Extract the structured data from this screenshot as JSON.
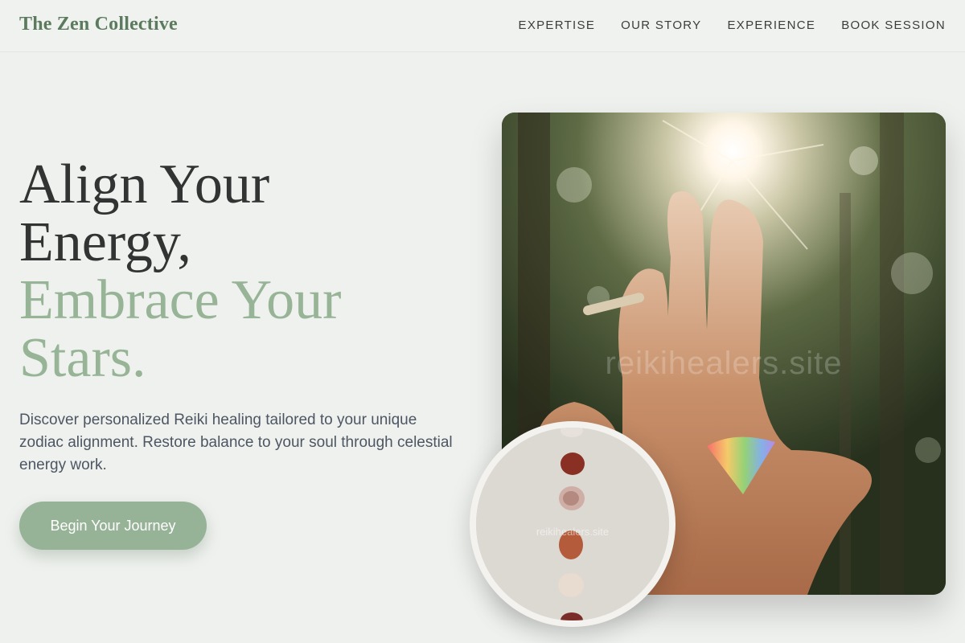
{
  "header": {
    "brand": "The Zen Collective",
    "nav": [
      "EXPERTISE",
      "OUR STORY",
      "EXPERIENCE",
      "BOOK SESSION"
    ]
  },
  "hero": {
    "headline_line1": "Align Your",
    "headline_line2": "Energy,",
    "headline_line3": "Embrace Your",
    "headline_line4": "Stars.",
    "description": "Discover personalized Reiki healing tailored to your unique zodiac alignment. Restore balance to your soul through celestial energy work.",
    "cta_label": "Begin Your Journey"
  },
  "images": {
    "main_watermark": "reikihealers.site",
    "inset_watermark": "reikihealers.site"
  },
  "colors": {
    "brand": "#5b7a5e",
    "accent_green": "#97b497",
    "button": "#96b397",
    "background": "#eff1ee"
  }
}
